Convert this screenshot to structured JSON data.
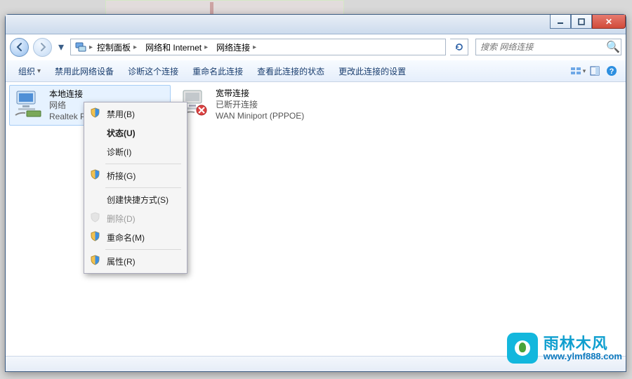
{
  "titlebar": {
    "minimize_tip": "Minimize",
    "maximize_tip": "Maximize",
    "close_tip": "Close"
  },
  "breadcrumb": {
    "seg1": "控制面板",
    "seg2": "网络和 Internet",
    "seg3": "网络连接"
  },
  "search": {
    "placeholder": "搜索 网络连接"
  },
  "toolbar": {
    "organize": "组织",
    "disable": "禁用此网络设备",
    "diagnose": "诊断这个连接",
    "rename": "重命名此连接",
    "status": "查看此连接的状态",
    "settings": "更改此连接的设置"
  },
  "connections": {
    "local": {
      "name": "本地连接",
      "line2": "网络",
      "line3": "Realtek PC"
    },
    "broadband": {
      "name": "宽带连接",
      "line2": "已断开连接",
      "line3": "WAN Miniport (PPPOE)"
    }
  },
  "context_menu": {
    "disable": "禁用(B)",
    "status": "状态(U)",
    "diagnose": "诊断(I)",
    "bridge": "桥接(G)",
    "shortcut": "创建快捷方式(S)",
    "delete": "删除(D)",
    "rename": "重命名(M)",
    "properties": "属性(R)"
  },
  "watermark": {
    "name": "雨林木风",
    "url": "www.ylmf888.com"
  }
}
